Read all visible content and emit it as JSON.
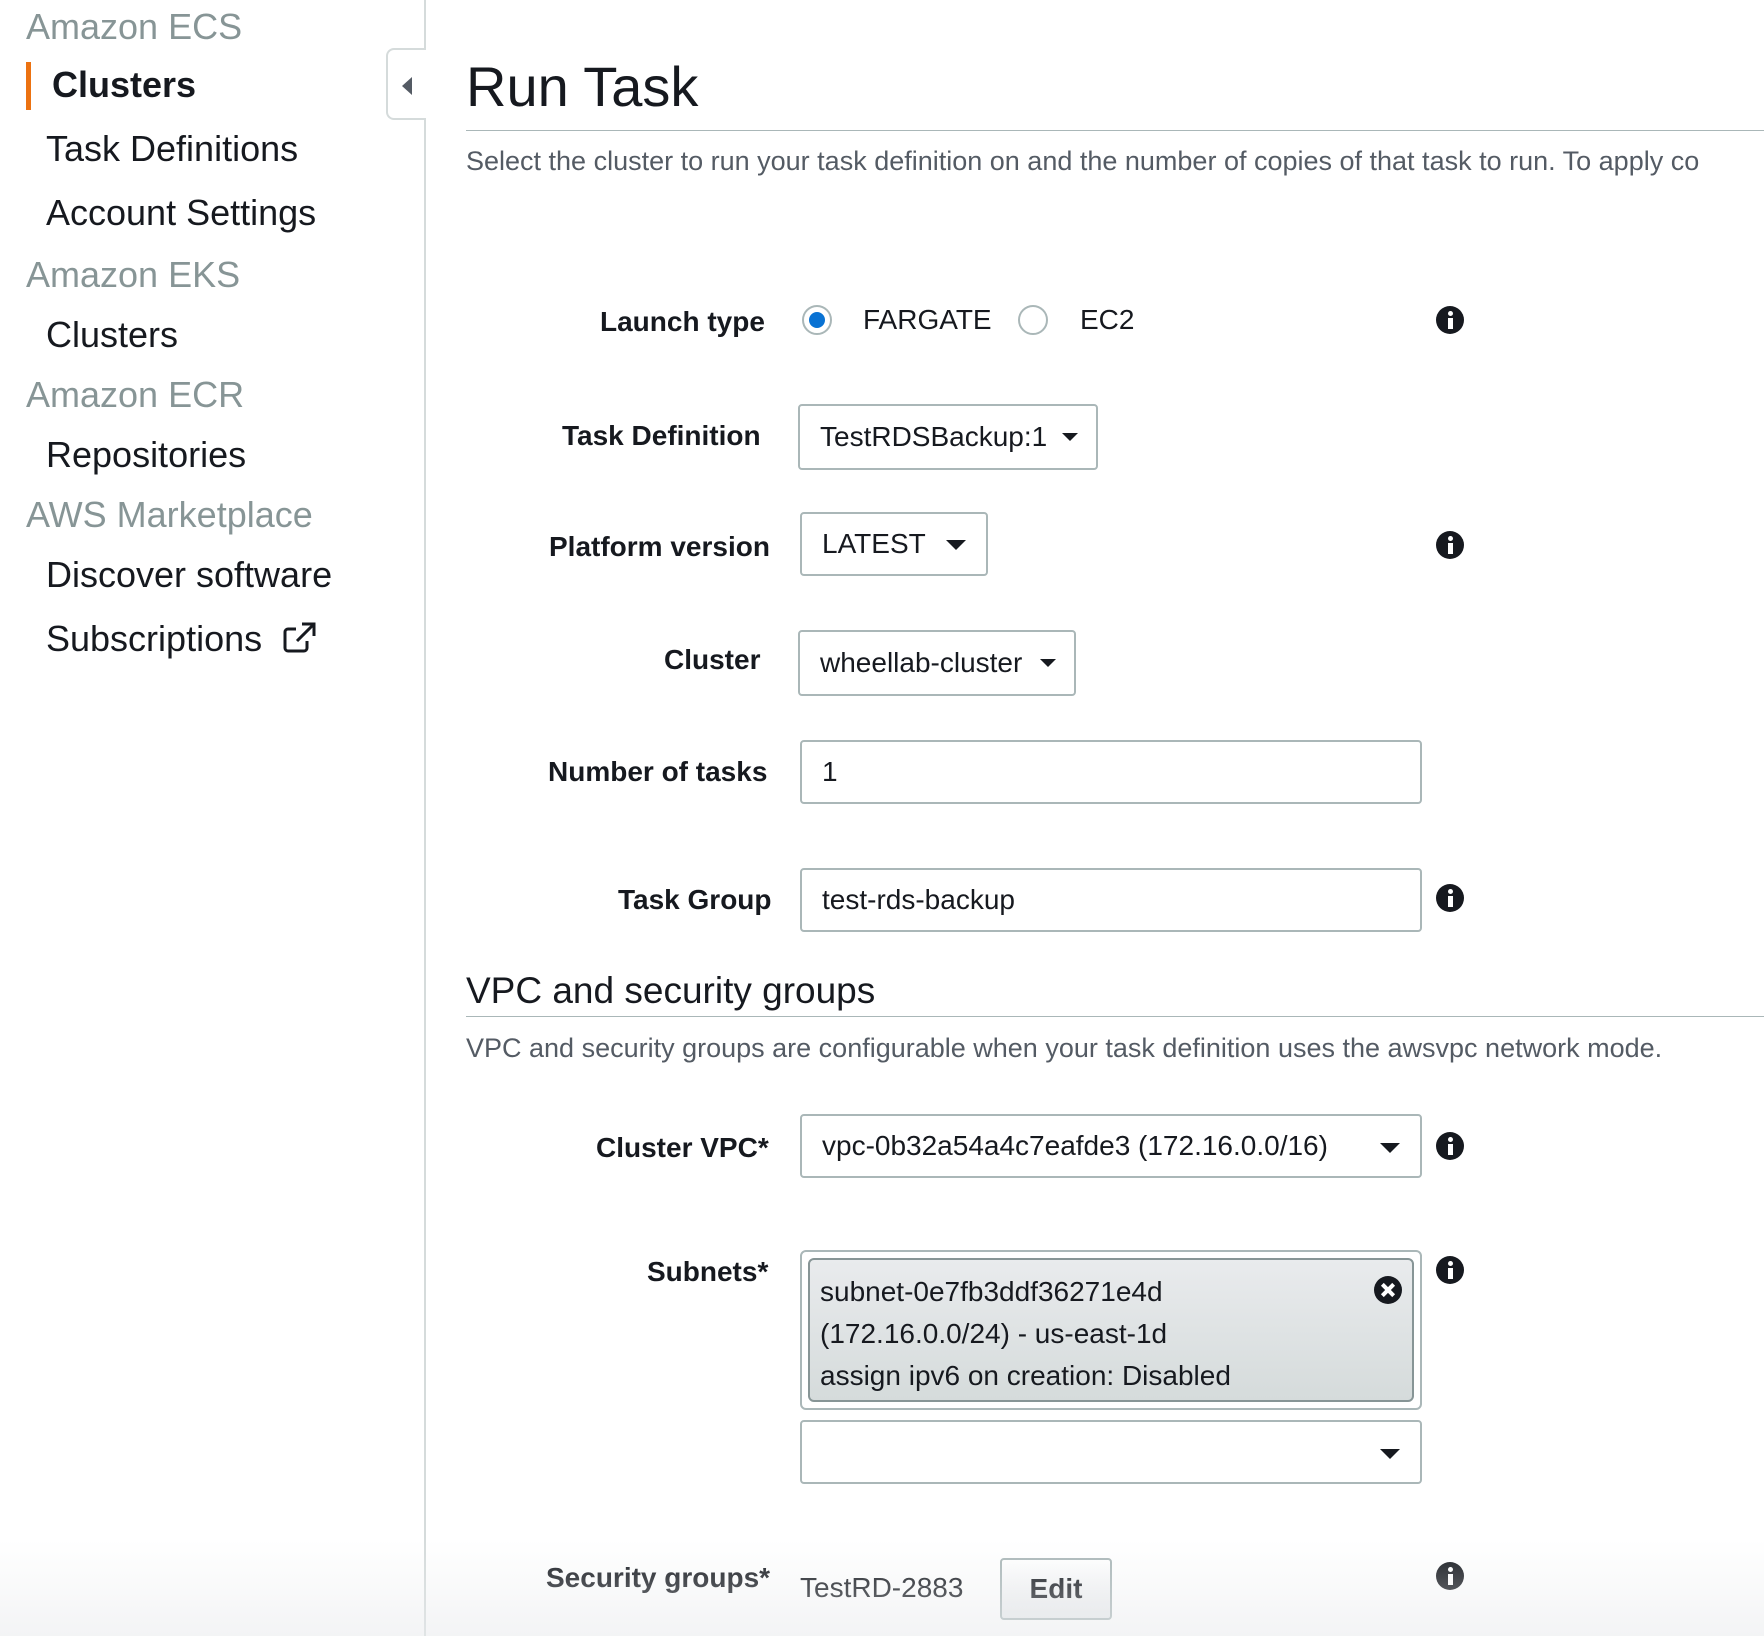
{
  "sidebar": {
    "sections": [
      {
        "title": "Amazon ECS",
        "items": [
          "Clusters",
          "Task Definitions",
          "Account Settings"
        ]
      },
      {
        "title": "Amazon EKS",
        "items": [
          "Clusters"
        ]
      },
      {
        "title": "Amazon ECR",
        "items": [
          "Repositories"
        ]
      },
      {
        "title": "AWS Marketplace",
        "items": [
          "Discover software",
          "Subscriptions"
        ]
      }
    ],
    "active_item": "Clusters",
    "accent_color": "#ec7211",
    "external_link_icon": "external-link-icon",
    "collapse_icon": "caret-left-icon"
  },
  "page": {
    "title": "Run Task",
    "description": "Select the cluster to run your task definition on and the number of copies of that task to run. To apply co"
  },
  "form": {
    "launch_type": {
      "label": "Launch type",
      "options": [
        "FARGATE",
        "EC2"
      ],
      "selected": "FARGATE"
    },
    "task_definition": {
      "label": "Task Definition",
      "value": "TestRDSBackup:1"
    },
    "platform_version": {
      "label": "Platform version",
      "value": "LATEST"
    },
    "cluster": {
      "label": "Cluster",
      "value": "wheellab-cluster"
    },
    "number_of_tasks": {
      "label": "Number of tasks",
      "value": "1"
    },
    "task_group": {
      "label": "Task Group",
      "value": "test-rds-backup"
    }
  },
  "vpc_section": {
    "title": "VPC and security groups",
    "description": "VPC and security groups are configurable when your task definition uses the awsvpc network mode.",
    "cluster_vpc": {
      "label": "Cluster VPC*",
      "value": "vpc-0b32a54a4c7eafde3 (172.16.0.0/16)"
    },
    "subnets": {
      "label": "Subnets*",
      "selected": {
        "line1": "subnet-0e7fb3ddf36271e4d",
        "line2": "(172.16.0.0/24) - us-east-1d",
        "line3": "assign ipv6 on creation: Disabled"
      },
      "dropdown_value": ""
    },
    "security_groups": {
      "label": "Security groups*",
      "value": "TestRD-2883",
      "edit_label": "Edit"
    }
  },
  "colors": {
    "radio_selected": "#0972d3",
    "text_primary": "#16191f",
    "text_secondary": "#545b64",
    "section_gray": "#879596"
  }
}
